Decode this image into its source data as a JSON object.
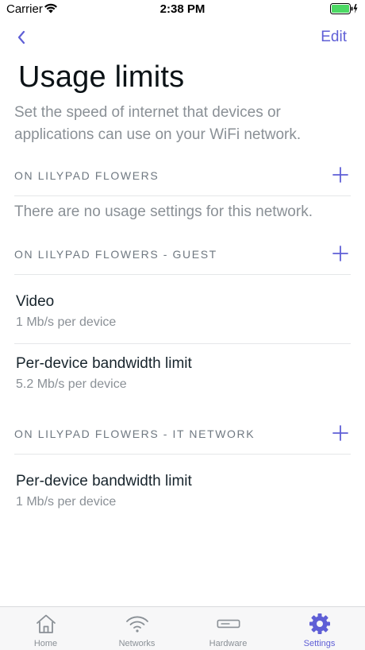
{
  "status_bar": {
    "carrier": "Carrier",
    "time": "2:38 PM"
  },
  "nav": {
    "edit_label": "Edit"
  },
  "page": {
    "title": "Usage limits",
    "description": "Set the speed of internet that devices or applications can use on your WiFi network."
  },
  "sections": [
    {
      "header": "ON LILYPAD FLOWERS",
      "empty_message": "There are no usage settings for this network."
    },
    {
      "header": "ON LILYPAD FLOWERS - GUEST",
      "rows": [
        {
          "title": "Video",
          "subtitle": "1 Mb/s per device"
        },
        {
          "title": "Per-device bandwidth limit",
          "subtitle": "5.2 Mb/s per device"
        }
      ]
    },
    {
      "header": "ON LILYPAD FLOWERS - IT NETWORK",
      "rows": [
        {
          "title": "Per-device bandwidth limit",
          "subtitle": "1 Mb/s per device"
        }
      ]
    }
  ],
  "tabs": [
    {
      "label": "Home",
      "icon": "home-icon"
    },
    {
      "label": "Networks",
      "icon": "wifi-icon"
    },
    {
      "label": "Hardware",
      "icon": "router-icon"
    },
    {
      "label": "Settings",
      "icon": "gear-icon",
      "active": true
    }
  ],
  "colors": {
    "accent": "#5f5fd6",
    "muted": "#8a9096",
    "battery": "#4cd964"
  }
}
